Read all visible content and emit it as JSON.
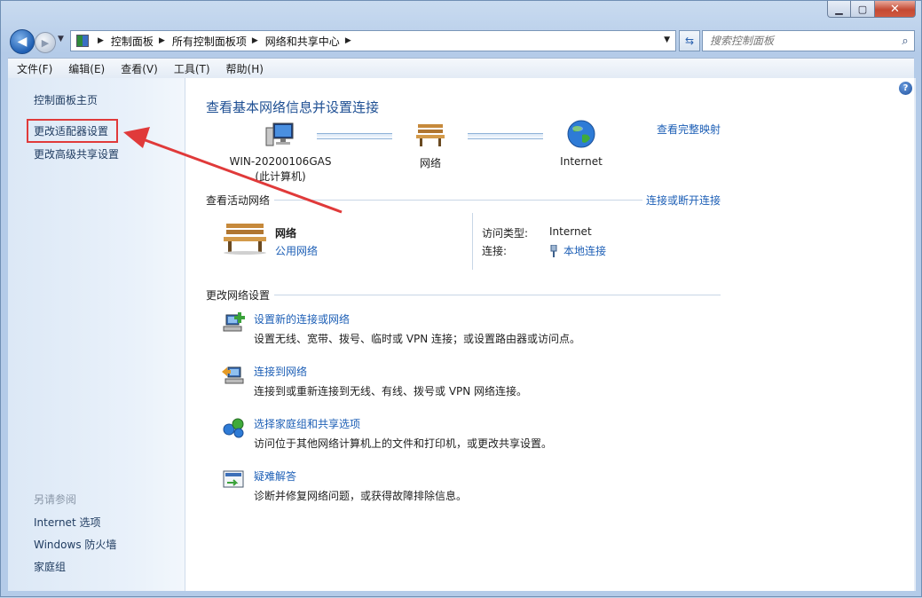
{
  "breadcrumb": [
    "控制面板",
    "所有控制面板项",
    "网络和共享中心"
  ],
  "search": {
    "placeholder": "搜索控制面板"
  },
  "menu": [
    "文件(F)",
    "编辑(E)",
    "查看(V)",
    "工具(T)",
    "帮助(H)"
  ],
  "sidebar": {
    "items": [
      "控制面板主页",
      "更改适配器设置",
      "更改高级共享设置"
    ],
    "see_also_title": "另请参阅",
    "see_also": [
      "Internet 选项",
      "Windows 防火墙",
      "家庭组"
    ]
  },
  "main": {
    "title": "查看基本网络信息并设置连接",
    "full_map": "查看完整映射",
    "nodes": {
      "computer": "WIN-20200106GAS",
      "computer_sub": "(此计算机)",
      "network": "网络",
      "internet": "Internet"
    },
    "active": {
      "heading": "查看活动网络",
      "connect_link": "连接或断开连接",
      "network_name": "网络",
      "network_type": "公用网络",
      "access_label": "访问类型:",
      "access_value": "Internet",
      "conn_label": "连接:",
      "conn_value": "本地连接"
    },
    "change": {
      "heading": "更改网络设置",
      "tasks": [
        {
          "title": "设置新的连接或网络",
          "desc": "设置无线、宽带、拨号、临时或 VPN 连接；或设置路由器或访问点。",
          "icon": "new-connection-icon"
        },
        {
          "title": "连接到网络",
          "desc": "连接到或重新连接到无线、有线、拨号或 VPN 网络连接。",
          "icon": "connect-network-icon"
        },
        {
          "title": "选择家庭组和共享选项",
          "desc": "访问位于其他网络计算机上的文件和打印机，或更改共享设置。",
          "icon": "homegroup-icon"
        },
        {
          "title": "疑难解答",
          "desc": "诊断并修复网络问题，或获得故障排除信息。",
          "icon": "troubleshoot-icon"
        }
      ]
    }
  },
  "annotation_color": "#e03a3a"
}
